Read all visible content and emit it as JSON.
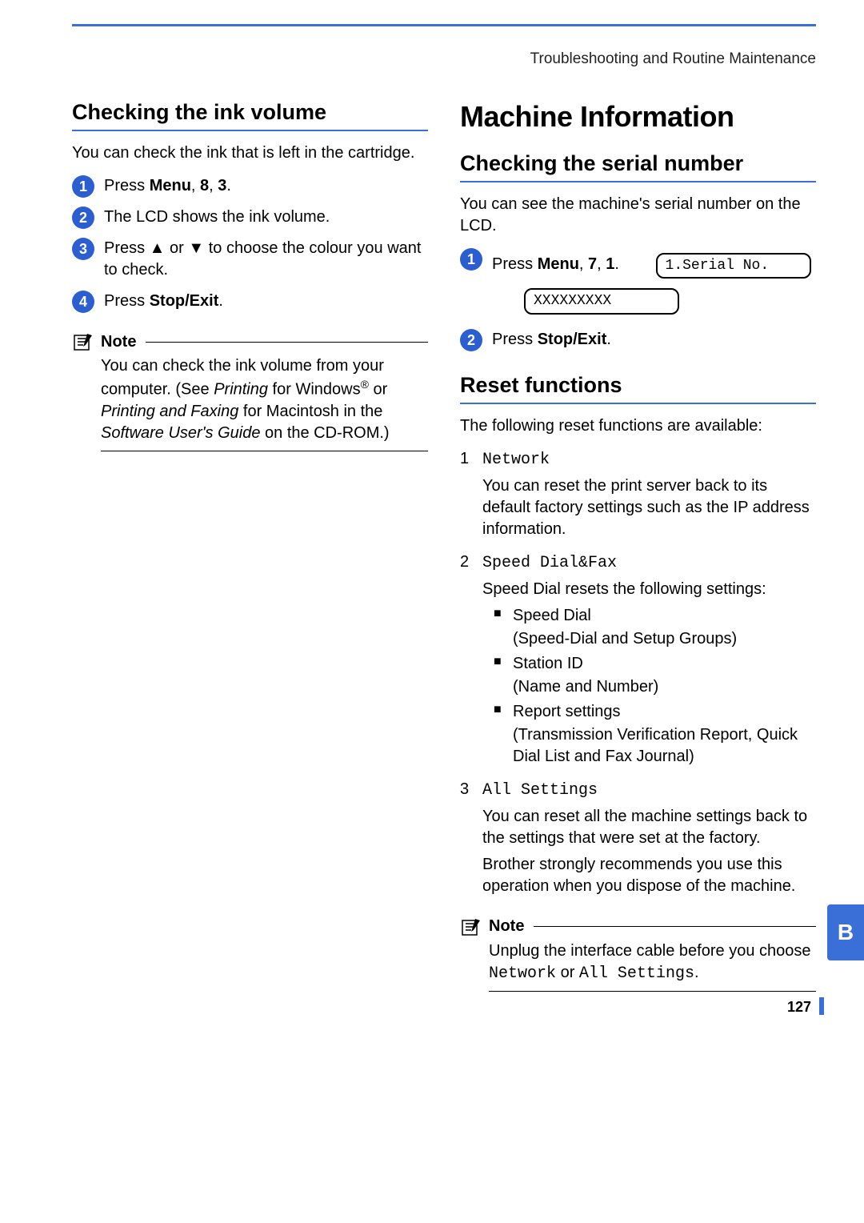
{
  "running_head": "Troubleshooting and Routine Maintenance",
  "page_number": "127",
  "side_tab": "B",
  "left": {
    "h2": "Checking the ink volume",
    "intro": "You can check the ink that is left in the cartridge.",
    "steps": {
      "s1_a": "Press ",
      "s1_b": "Menu",
      "s1_c": ", ",
      "s1_d": "8",
      "s1_e": ", ",
      "s1_f": "3",
      "s1_g": ".",
      "s2": "The LCD shows the ink volume.",
      "s3": "Press ▲ or ▼ to choose the colour you want to check.",
      "s4_a": "Press ",
      "s4_b": "Stop/Exit",
      "s4_c": "."
    },
    "note_label": "Note",
    "note_l1": "You can check the ink volume from your computer. (See ",
    "note_l2": "Printing",
    "note_l3": " for Windows",
    "note_reg": "®",
    "note_l4": " or ",
    "note_l5": "Printing and Faxing",
    "note_l6": " for Macintosh in the ",
    "note_l7": "Software User's Guide",
    "note_l8": " on the CD-ROM.)"
  },
  "right": {
    "h1": "Machine Information",
    "serial": {
      "h2": "Checking the serial number",
      "intro": "You can see the machine's serial number on the LCD.",
      "s1_a": "Press ",
      "s1_b": "Menu",
      "s1_c": ", ",
      "s1_d": "7",
      "s1_e": ", ",
      "s1_f": "1",
      "s1_g": ".",
      "lcd1": "1.Serial No.",
      "lcd2": "XXXXXXXXX",
      "s2_a": "Press ",
      "s2_b": "Stop/Exit",
      "s2_c": "."
    },
    "reset": {
      "h2": "Reset functions",
      "intro": "The following reset functions are available:",
      "items": {
        "n1_num": "1",
        "n1_title": "Network",
        "n1_body": "You can reset the print server back to its default factory settings such as the IP address information.",
        "n2_num": "2",
        "n2_title": "Speed Dial&Fax",
        "n2_intro": "Speed Dial resets the following settings:",
        "n2_b1": "Speed Dial",
        "n2_b1s": "(Speed-Dial and Setup Groups)",
        "n2_b2": "Station ID",
        "n2_b2s": "(Name and Number)",
        "n2_b3": "Report settings",
        "n2_b3s": "(Transmission Verification Report, Quick Dial List and Fax Journal)",
        "n3_num": "3",
        "n3_title": "All Settings",
        "n3_body1": "You can reset all the machine settings back to the settings that were set at the factory.",
        "n3_body2": "Brother strongly recommends you use this operation when you dispose of the machine."
      },
      "note_label": "Note",
      "note_a": "Unplug the interface cable before you choose ",
      "note_b": "Network",
      "note_c": " or ",
      "note_d": "All Settings",
      "note_e": "."
    }
  }
}
